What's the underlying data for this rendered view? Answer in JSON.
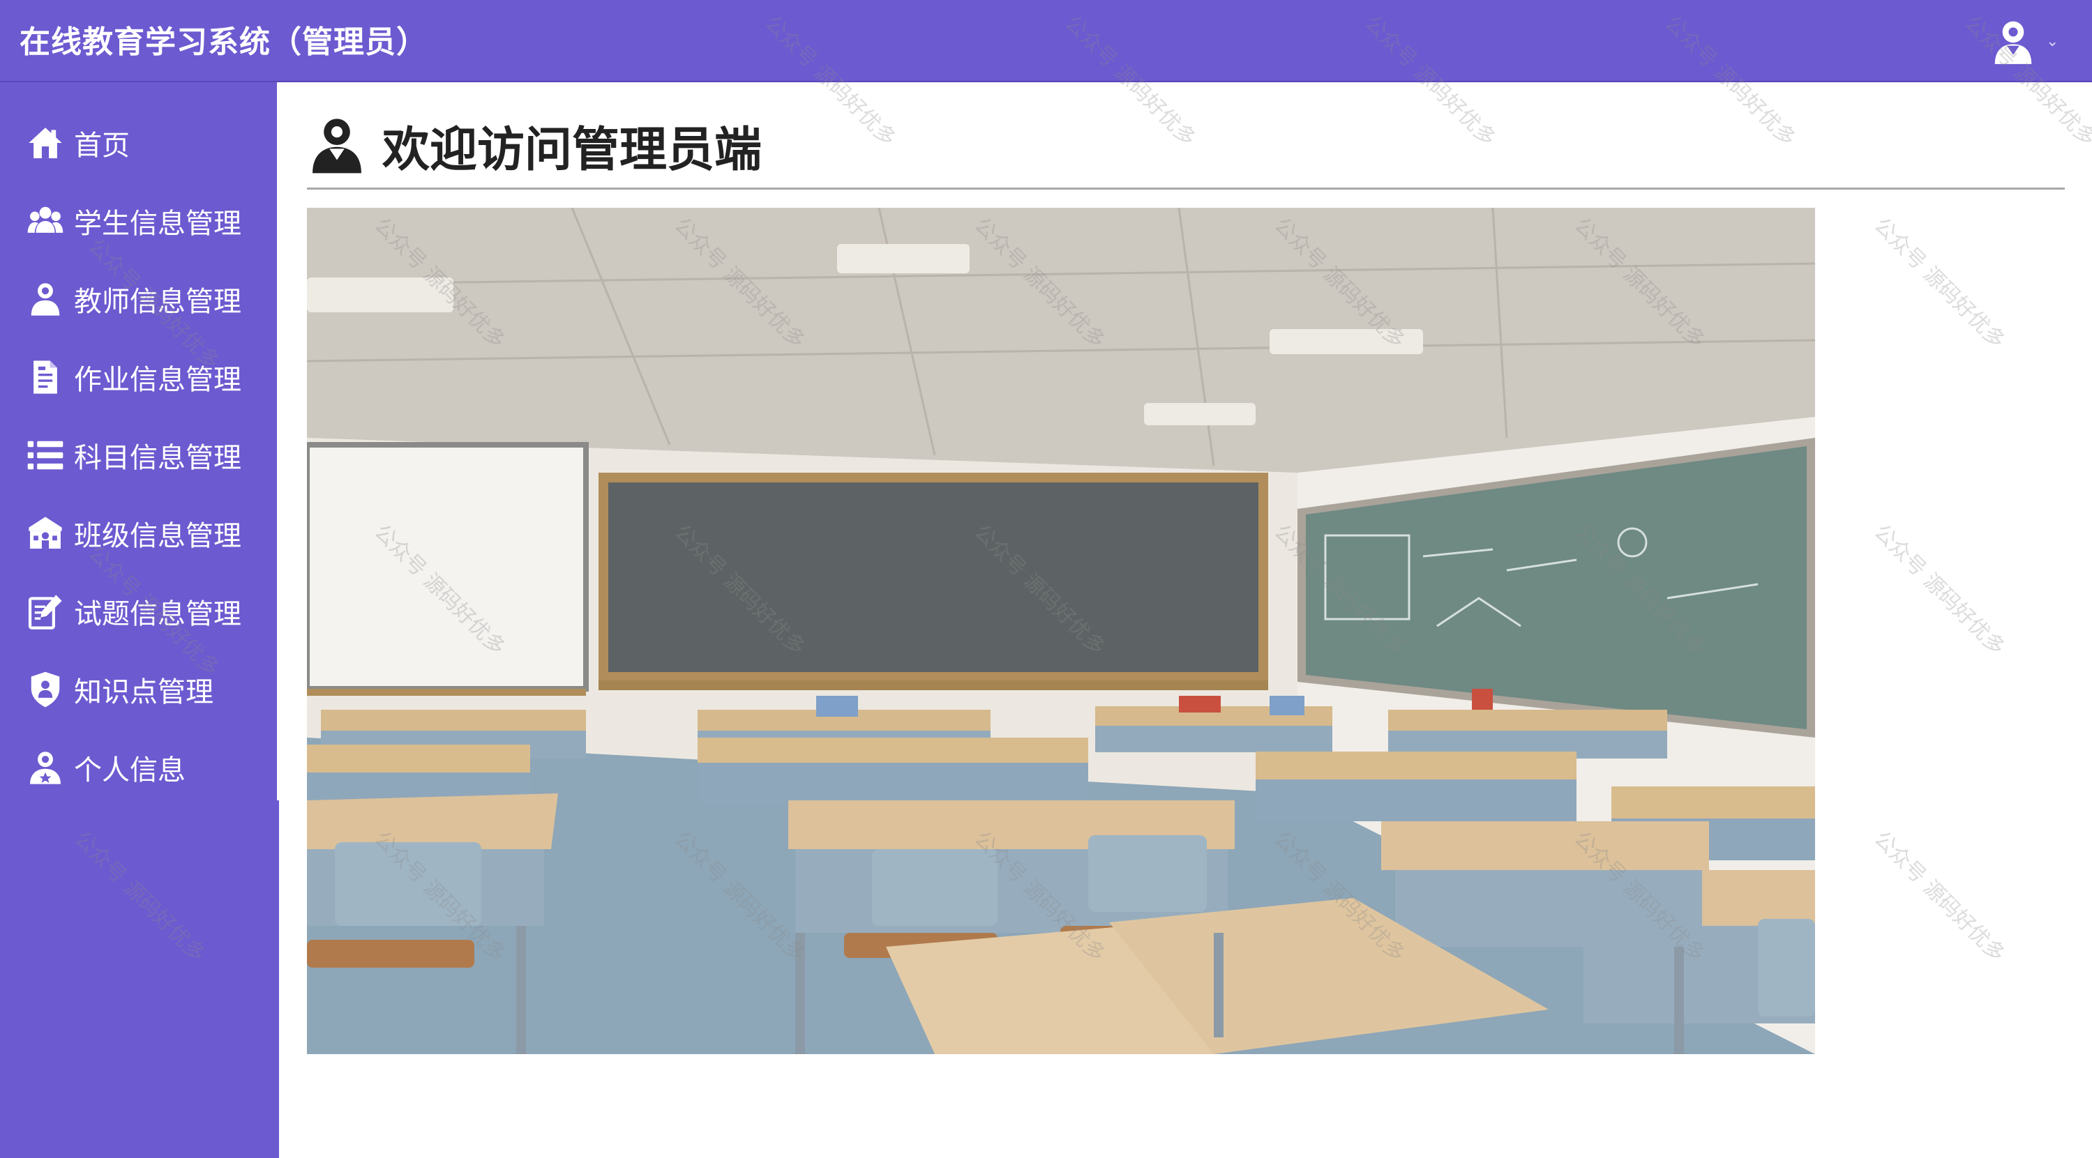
{
  "header": {
    "title": "在线教育学习系统（管理员）",
    "user_icon": "user-avatar-icon",
    "caret_glyph": "⌄"
  },
  "sidebar": {
    "items": [
      {
        "label": "首页",
        "icon": "home-icon"
      },
      {
        "label": "学生信息管理",
        "icon": "users-icon"
      },
      {
        "label": "教师信息管理",
        "icon": "user-icon"
      },
      {
        "label": "作业信息管理",
        "icon": "document-icon"
      },
      {
        "label": "科目信息管理",
        "icon": "list-icon"
      },
      {
        "label": "班级信息管理",
        "icon": "school-icon"
      },
      {
        "label": "试题信息管理",
        "icon": "edit-document-icon"
      },
      {
        "label": "知识点管理",
        "icon": "shield-icon"
      },
      {
        "label": "个人信息",
        "icon": "user-star-icon"
      }
    ]
  },
  "main": {
    "welcome": "欢迎访问管理员端",
    "welcome_icon": "user-icon",
    "image_subject": "classroom-photo"
  },
  "watermark": {
    "text": "公众号 源码好优多"
  },
  "colors": {
    "brand": "#6c5ad0",
    "header_text": "#ffffff",
    "welcome_text": "#222222",
    "divider": "#a8a8a8"
  }
}
